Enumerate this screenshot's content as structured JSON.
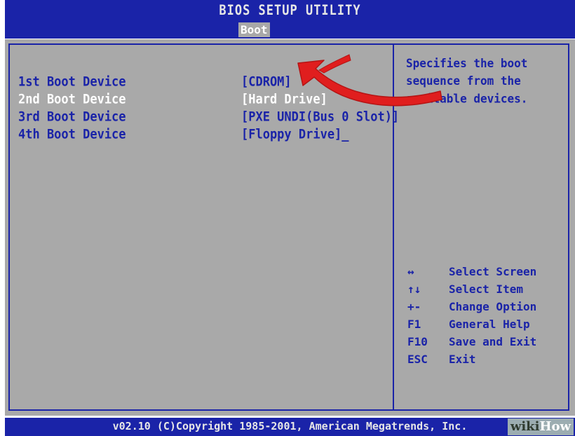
{
  "header": {
    "title": "BIOS SETUP UTILITY",
    "active_tab": "Boot"
  },
  "boot_devices": [
    {
      "label": "1st Boot Device",
      "value": "[CDROM]",
      "highlighted": false
    },
    {
      "label": "2nd Boot Device",
      "value": "[Hard Drive]",
      "highlighted": true
    },
    {
      "label": "3rd Boot Device",
      "value": "[PXE UNDI(Bus 0 Slot)]",
      "highlighted": false
    },
    {
      "label": "4th Boot Device",
      "value": "[Floppy Drive]_",
      "highlighted": false
    }
  ],
  "help_text": "Specifies the boot sequence from the available devices.",
  "key_legend": [
    {
      "key": "↔",
      "action": "Select Screen"
    },
    {
      "key": "↑↓",
      "action": "Select Item"
    },
    {
      "key": "+-",
      "action": "Change Option"
    },
    {
      "key": "F1",
      "action": "General Help"
    },
    {
      "key": "F10",
      "action": "Save and Exit"
    },
    {
      "key": "ESC",
      "action": "Exit"
    }
  ],
  "footer": {
    "copyright": "v02.10 (C)Copyright 1985-2001, American Megatrends, Inc."
  },
  "watermark": {
    "part1": "wiki",
    "part2": "How"
  },
  "colors": {
    "bios_blue": "#1a23a8",
    "panel_gray": "#a9a9a9",
    "arrow_red": "#e01e1e"
  }
}
